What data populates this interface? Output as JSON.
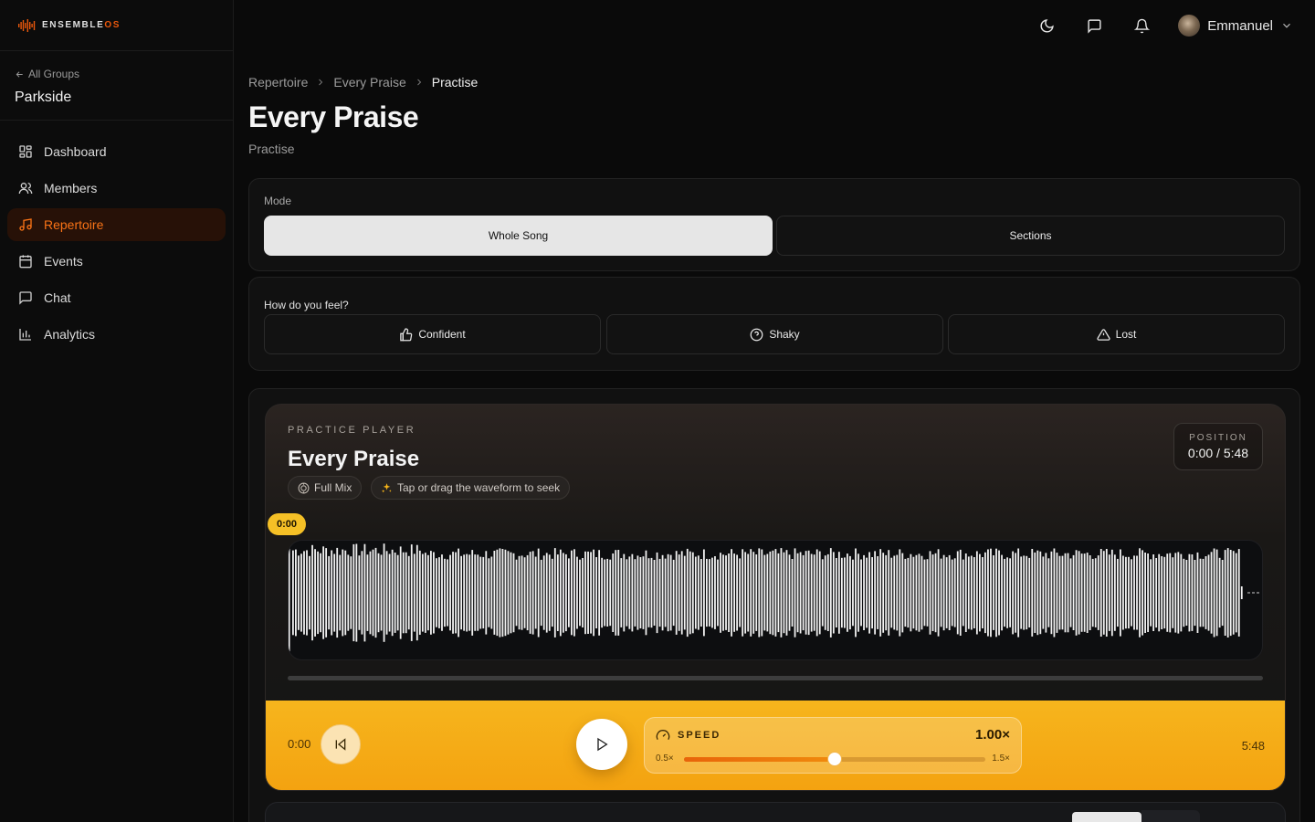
{
  "brand": {
    "name_main": "ENSEMBLE",
    "name_accent": "OS",
    "accent_color": "#f97316",
    "highlight_color": "#f5b419"
  },
  "sidebar": {
    "back_label": "All Groups",
    "group_name": "Parkside",
    "items": [
      {
        "label": "Dashboard",
        "icon": "dashboard-icon",
        "active": false
      },
      {
        "label": "Members",
        "icon": "members-icon",
        "active": false
      },
      {
        "label": "Repertoire",
        "icon": "music-note-icon",
        "active": true
      },
      {
        "label": "Events",
        "icon": "calendar-icon",
        "active": false
      },
      {
        "label": "Chat",
        "icon": "chat-icon",
        "active": false
      },
      {
        "label": "Analytics",
        "icon": "bar-chart-icon",
        "active": false
      }
    ]
  },
  "topbar": {
    "user_name": "Emmanuel",
    "icons": [
      "moon-icon",
      "message-icon",
      "bell-icon",
      "chevron-down-icon"
    ]
  },
  "breadcrumb": [
    "Repertoire",
    "Every Praise",
    "Practise"
  ],
  "page": {
    "title": "Every Praise",
    "subtitle": "Practise"
  },
  "mode": {
    "label": "Mode",
    "options": [
      "Whole Song",
      "Sections"
    ],
    "selected": "Whole Song"
  },
  "feel": {
    "label": "How do you feel?",
    "options": [
      {
        "label": "Confident",
        "icon": "thumbs-up-icon"
      },
      {
        "label": "Shaky",
        "icon": "help-circle-icon"
      },
      {
        "label": "Lost",
        "icon": "warning-triangle-icon"
      }
    ]
  },
  "player": {
    "kicker": "PRACTICE PLAYER",
    "title": "Every Praise",
    "chips": [
      {
        "label": "Full Mix",
        "icon": "mix-icon"
      },
      {
        "label": "Tap or drag the waveform to seek",
        "icon": "sparkle-icon"
      }
    ],
    "position_label": "POSITION",
    "position_value": "0:00 / 5:48",
    "current_time_pill": "0:00",
    "progress": 0,
    "time_start": "0:00",
    "time_end": "5:48",
    "speed": {
      "label": "SPEED",
      "value": "1.00×",
      "min_label": "0.5×",
      "max_label": "1.5×",
      "min": 0.5,
      "max": 1.5,
      "current": 1.0
    }
  }
}
